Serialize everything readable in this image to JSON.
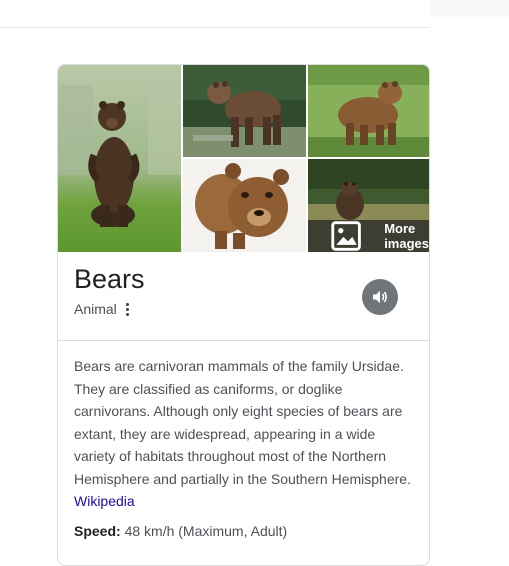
{
  "knowledge_panel": {
    "title": "Bears",
    "subtitle": "Animal",
    "more_images_label": "More images",
    "description": "Bears are carnivoran mammals of the family Ursidae. They are classified as caniforms, or doglike carnivorans. Although only eight species of bears are extant, they are widespread, appearing in a wide variety of habitats throughout most of the Northern Hemisphere and partially in the Southern Hemisphere.",
    "source_link": "Wikipedia",
    "facts": [
      {
        "label": "Speed:",
        "value": "48 km/h (Maximum, Adult)"
      }
    ]
  },
  "icons": {
    "more_images": "image-icon",
    "audio": "speaker-icon",
    "menu": "vertical-dots-icon"
  },
  "colors": {
    "link": "#1a0dab",
    "title": "#202124",
    "body_text": "#4d5156",
    "audio_button": "#70757a",
    "border": "#dadce0"
  }
}
